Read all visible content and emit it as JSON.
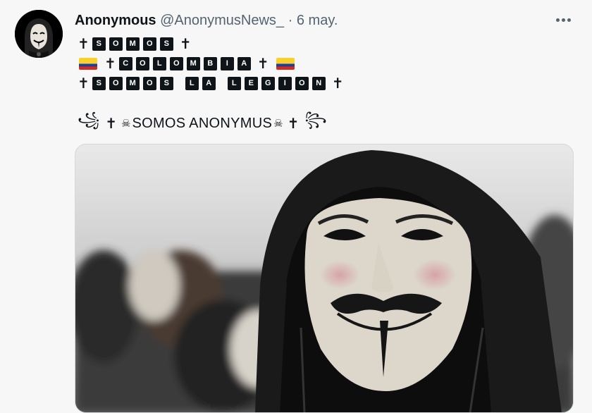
{
  "tweet": {
    "author_name": "Anonymous",
    "author_handle": "@AnonymusNews_",
    "separator": "·",
    "date": "6 may.",
    "more_icon": "ellipsis-icon",
    "line1": {
      "letters": [
        "S",
        "O",
        "M",
        "O",
        "S"
      ],
      "deco": "✝"
    },
    "line2": {
      "letters": [
        "C",
        "O",
        "L",
        "O",
        "M",
        "B",
        "I",
        "A"
      ],
      "deco": "✝",
      "flag": "colombia-flag-icon"
    },
    "line3": {
      "word1": [
        "S",
        "O",
        "M",
        "O",
        "S"
      ],
      "word2": [
        "L",
        "A"
      ],
      "word3": [
        "L",
        "E",
        "G",
        "I",
        "O",
        "N"
      ],
      "deco": "✝"
    },
    "line4": {
      "text": "SOMOS ANONYMUS",
      "skull": "☠",
      "deco": "✝",
      "swirl_left": "꧁",
      "swirl_right": "꧂"
    },
    "media": {
      "subject": "person-in-hood-guy-fawkes-mask-photo"
    }
  },
  "colors": {
    "text": "#0f1419",
    "secondary": "#536471",
    "background": "#f7f7f7"
  }
}
